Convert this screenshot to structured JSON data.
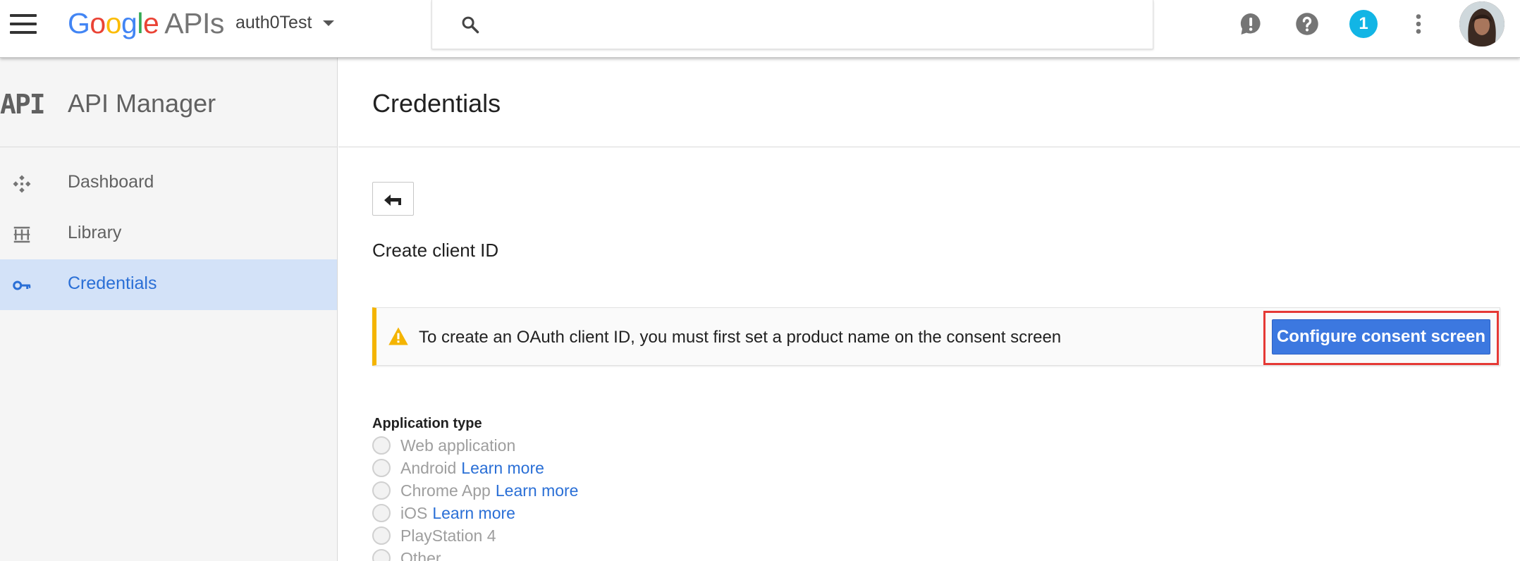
{
  "header": {
    "logo_google": [
      "G",
      "o",
      "o",
      "g",
      "l",
      "e"
    ],
    "logo_apis": "APIs",
    "project_name": "auth0Test",
    "search_placeholder": "",
    "notification_count": "1"
  },
  "sidebar": {
    "brand_mark": "API",
    "title": "API Manager",
    "items": [
      {
        "label": "Dashboard",
        "icon": "dashboard-icon"
      },
      {
        "label": "Library",
        "icon": "library-icon"
      },
      {
        "label": "Credentials",
        "icon": "key-icon",
        "active": true
      }
    ]
  },
  "main": {
    "title": "Credentials",
    "subtitle": "Create client ID",
    "warning": {
      "text": "To create an OAuth client ID, you must first set a product name on the consent screen",
      "button_label": "Configure consent screen"
    },
    "application_type": {
      "label": "Application type",
      "options": [
        {
          "label": "Web application",
          "link": ""
        },
        {
          "label": "Android",
          "link": "Learn more"
        },
        {
          "label": "Chrome App",
          "link": "Learn more"
        },
        {
          "label": "iOS",
          "link": "Learn more"
        },
        {
          "label": "PlayStation 4",
          "link": ""
        },
        {
          "label": "Other",
          "link": ""
        }
      ]
    }
  },
  "colors": {
    "accent": "#3c78e0",
    "warning": "#f4b400",
    "highlight": "#e53935",
    "active_nav_bg": "#d3e2f8",
    "notification": "#12b5e5"
  }
}
